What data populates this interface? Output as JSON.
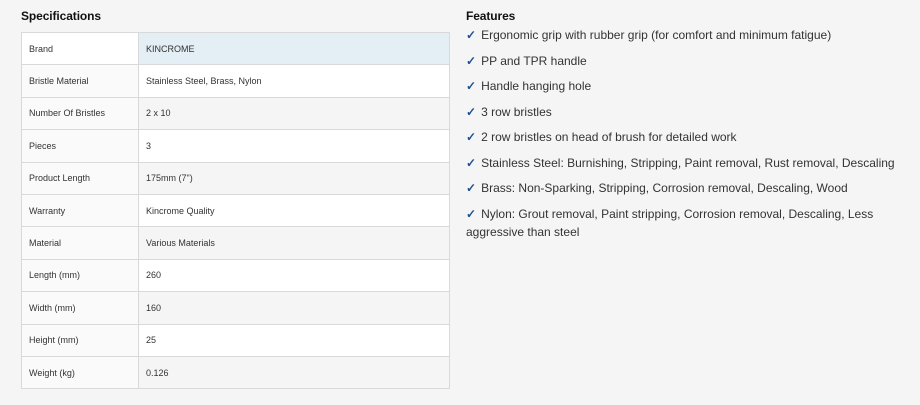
{
  "specifications": {
    "title": "Specifications",
    "rows": [
      {
        "label": "Brand",
        "value": "KINCROME"
      },
      {
        "label": "Bristle Material",
        "value": "Stainless Steel, Brass, Nylon"
      },
      {
        "label": "Number Of Bristles",
        "value": "2 x 10"
      },
      {
        "label": "Pieces",
        "value": "3"
      },
      {
        "label": "Product Length",
        "value": "175mm (7\")"
      },
      {
        "label": "Warranty",
        "value": "Kincrome Quality"
      },
      {
        "label": "Material",
        "value": "Various Materials"
      },
      {
        "label": "Length (mm)",
        "value": "260"
      },
      {
        "label": "Width (mm)",
        "value": "160"
      },
      {
        "label": "Height (mm)",
        "value": "25"
      },
      {
        "label": "Weight (kg)",
        "value": "0.126"
      }
    ]
  },
  "features": {
    "title": "Features",
    "check_icon": "check-icon",
    "check_glyph": "✓",
    "accent_color": "#1f4f8f",
    "items": [
      "Ergonomic grip with rubber grip (for comfort and minimum fatigue)",
      "PP and TPR handle",
      "Handle hanging hole",
      "3 row bristles",
      "2 row bristles on head of brush for detailed work",
      "Stainless Steel: Burnishing, Stripping, Paint removal, Rust removal, Descaling",
      "Brass: Non-Sparking, Stripping, Corrosion removal, Descaling, Wood",
      "Nylon: Grout removal, Paint stripping, Corrosion removal, Descaling, Less aggressive than steel"
    ]
  }
}
